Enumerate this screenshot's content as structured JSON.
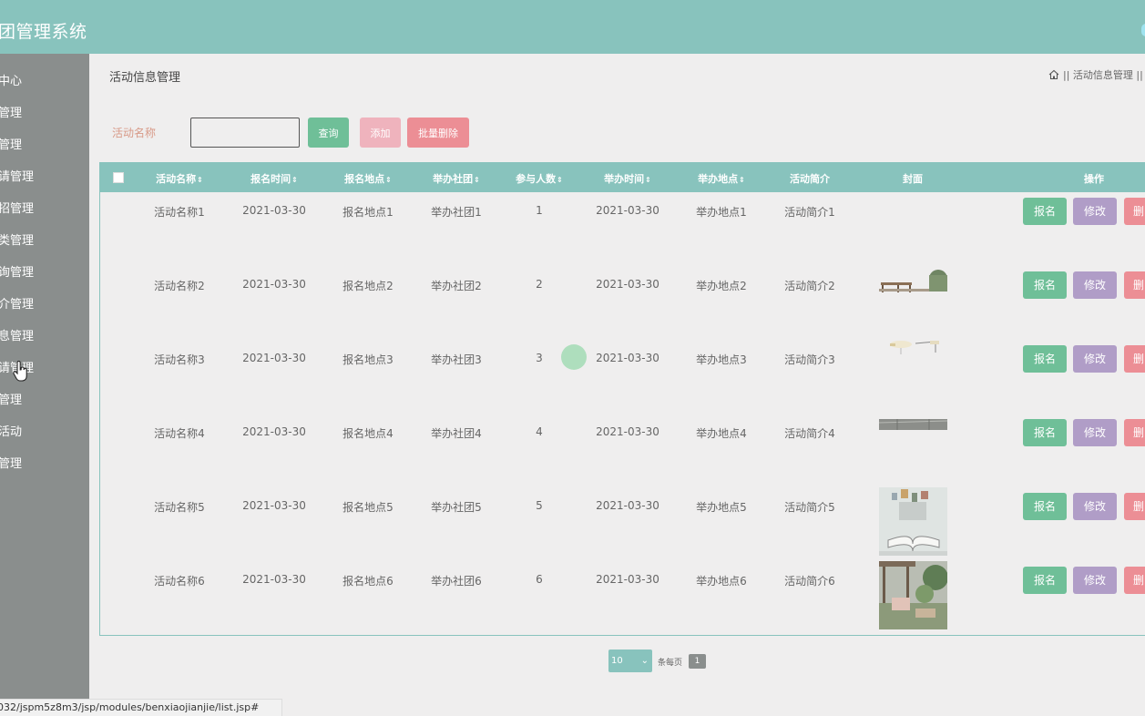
{
  "app": {
    "title": "团管理系统"
  },
  "sidebar": {
    "items": [
      {
        "label": "中心"
      },
      {
        "label": "管理"
      },
      {
        "label": "管理"
      },
      {
        "label": "请管理"
      },
      {
        "label": "招管理"
      },
      {
        "label": "类管理"
      },
      {
        "label": "询管理"
      },
      {
        "label": "介管理"
      },
      {
        "label": "息管理"
      },
      {
        "label": "请管理"
      },
      {
        "label": "管理"
      },
      {
        "label": "活动"
      },
      {
        "label": "管理"
      }
    ]
  },
  "page": {
    "title": "活动信息管理",
    "breadcrumb": "|| 活动信息管理 ||"
  },
  "search": {
    "label": "活动名称",
    "value": "",
    "query_label": "查询",
    "add_label": "添加",
    "batch_delete_label": "批量删除"
  },
  "table": {
    "headers": [
      "活动名称",
      "报名时间",
      "报名地点",
      "举办社团",
      "参与人数",
      "举办时间",
      "举办地点",
      "活动简介",
      "封面",
      "操作"
    ],
    "sort_glyph": "⇕",
    "rows": [
      {
        "name": "活动名称1",
        "signup_time": "2021-03-30",
        "signup_place": "报名地点1",
        "club": "举办社团1",
        "count": "1",
        "hold_time": "2021-03-30",
        "hold_place": "举办地点1",
        "intro": "活动简介1",
        "cover": "none"
      },
      {
        "name": "活动名称2",
        "signup_time": "2021-03-30",
        "signup_place": "报名地点2",
        "club": "举办社团2",
        "count": "2",
        "hold_time": "2021-03-30",
        "hold_place": "举办地点2",
        "intro": "活动简介2",
        "cover": "pavilion"
      },
      {
        "name": "活动名称3",
        "signup_time": "2021-03-30",
        "signup_place": "报名地点3",
        "club": "举办社团3",
        "count": "3",
        "hold_time": "2021-03-30",
        "hold_place": "举办地点3",
        "intro": "活动简介3",
        "cover": "lamps"
      },
      {
        "name": "活动名称4",
        "signup_time": "2021-03-30",
        "signup_place": "报名地点4",
        "club": "举办社团4",
        "count": "4",
        "hold_time": "2021-03-30",
        "hold_place": "举办地点4",
        "intro": "活动简介4",
        "cover": "ceiling"
      },
      {
        "name": "活动名称5",
        "signup_time": "2021-03-30",
        "signup_place": "报名地点5",
        "club": "举办社团5",
        "count": "5",
        "hold_time": "2021-03-30",
        "hold_place": "举办地点5",
        "intro": "活动简介5",
        "cover": "book"
      },
      {
        "name": "活动名称6",
        "signup_time": "2021-03-30",
        "signup_place": "报名地点6",
        "club": "举办社团6",
        "count": "6",
        "hold_time": "2021-03-30",
        "hold_place": "举办地点6",
        "intro": "活动简介6",
        "cover": "garden"
      }
    ],
    "actions": {
      "enroll": "报名",
      "edit": "修改",
      "delete": "删"
    }
  },
  "pagination": {
    "page_size": "10",
    "per_page_label": "条每页",
    "current_page": "1"
  },
  "statusbar": {
    "url": "032/jspm5z8m3/jsp/modules/benxiaojianjie/list.jsp#"
  },
  "colors": {
    "header": "#88c3bd",
    "sidebar": "#8a8e8d",
    "primary_green": "#6fbf98",
    "purple": "#b09dc7",
    "red": "#ec8e95"
  }
}
